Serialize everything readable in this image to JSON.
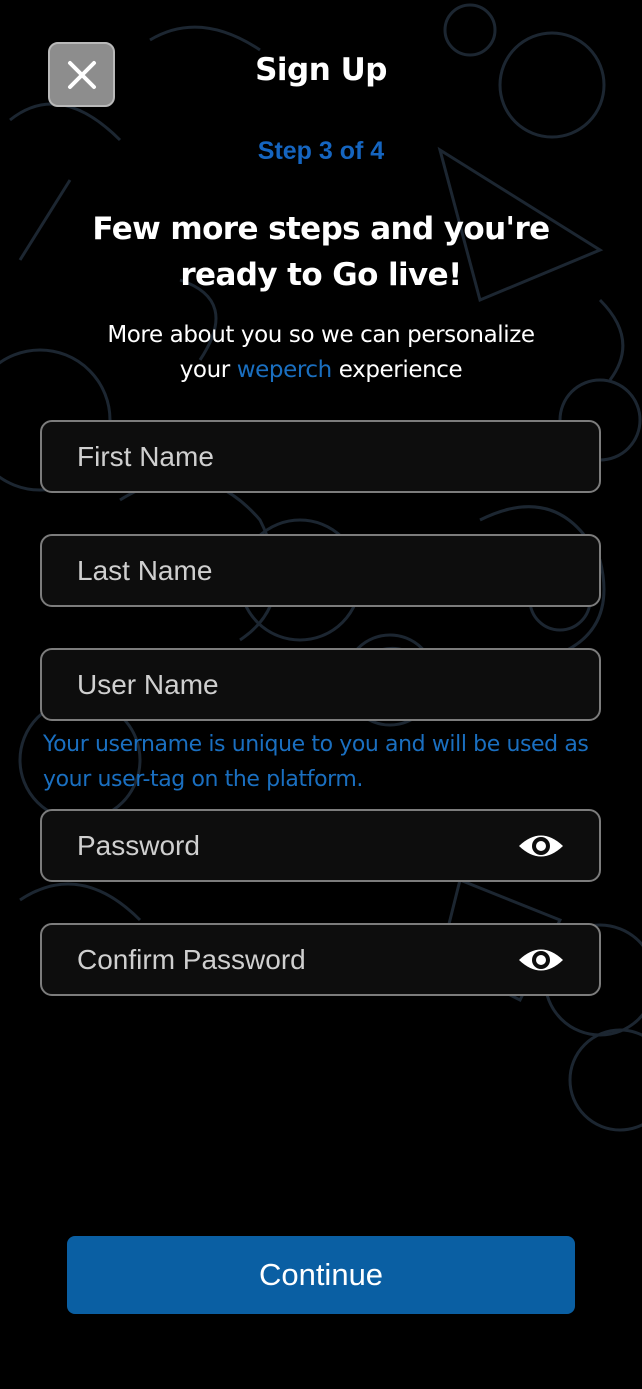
{
  "colors": {
    "accent": "#0a5fa3",
    "link": "#1a6fc0",
    "step": "#1565c0",
    "background": "#000000",
    "field_border": "#7c7c7c"
  },
  "header": {
    "close_icon": "close-icon",
    "title": "Sign Up"
  },
  "step": {
    "label": "Step 3 of 4"
  },
  "intro": {
    "headline_line1": "Few more steps and you're",
    "headline_line2": "ready to Go live!",
    "subtitle_before": "More about you so we can personalize",
    "subtitle_your": "your",
    "brand": "weperch",
    "subtitle_after": "experience"
  },
  "form": {
    "first_name": {
      "placeholder": "First Name",
      "value": ""
    },
    "last_name": {
      "placeholder": "Last Name",
      "value": ""
    },
    "user_name": {
      "placeholder": "User Name",
      "value": ""
    },
    "username_help": "Your username is unique to you and will be used as your user-tag on the platform.",
    "password": {
      "placeholder": "Password",
      "value": "",
      "toggle_icon": "eye-icon"
    },
    "confirm_password": {
      "placeholder": "Confirm Password",
      "value": "",
      "toggle_icon": "eye-icon"
    }
  },
  "actions": {
    "continue_label": "Continue"
  }
}
